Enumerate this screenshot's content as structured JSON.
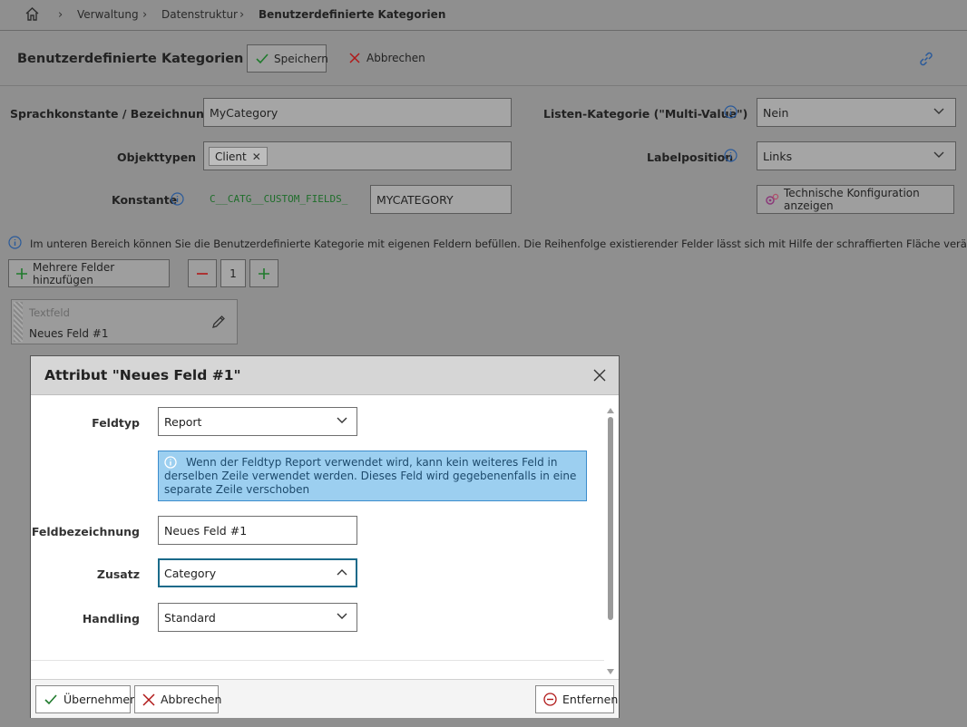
{
  "breadcrumb": {
    "items": [
      "Verwaltung",
      "Datenstruktur",
      "Benutzerdefinierte Kategorien"
    ]
  },
  "header": {
    "title": "Benutzerdefinierte Kategorien",
    "save_label": "Speichern",
    "cancel_label": "Abbrechen"
  },
  "form": {
    "name_label": "Sprachkonstante / Bezeichnung",
    "name_value": "MyCategory",
    "objecttypes_label": "Objekttypen",
    "objecttypes_tag": "Client",
    "constant_label": "Konstante",
    "constant_prefix": "C__CATG__CUSTOM_FIELDS_",
    "constant_value": "MYCATEGORY",
    "multivalue_label": "Listen-Kategorie (\"Multi-Value\")",
    "multivalue_value": "Nein",
    "labelpos_label": "Labelposition",
    "labelpos_value": "Links",
    "tech_config_label": "Technische Konfiguration anzeigen"
  },
  "info_text": "Im unteren Bereich können Sie die Benutzerdefinierte Kategorie mit eigenen Feldern befüllen. Die Reihenfolge existierender Felder lässt sich mit Hilfe der schraffierten Fläche verändern.",
  "fields_toolbar": {
    "add_label": "Mehrere Felder hinzufügen",
    "count": "1"
  },
  "field_card": {
    "type": "Textfeld",
    "name": "Neues Feld #1"
  },
  "modal": {
    "title": "Attribut \"Neues Feld #1\"",
    "feldtyp_label": "Feldtyp",
    "feldtyp_value": "Report",
    "info": "Wenn der Feldtyp Report verwendet wird, kann kein weiteres Feld in derselben Zeile verwendet werden. Dieses Feld wird gegebenenfalls in eine separate Zeile verschoben",
    "bezeichnung_label": "Feldbezeichnung",
    "bezeichnung_value": "Neues Feld #1",
    "zusatz_label": "Zusatz",
    "zusatz_value": "Category",
    "handling_label": "Handling",
    "handling_value": "Standard",
    "apply_label": "Übernehmen",
    "cancel_label": "Abbrechen",
    "remove_label": "Entfernen"
  },
  "colors": {
    "overlay": "#8f8f8f",
    "info_box": "#9ccff0",
    "focus_border": "#1a6a8a",
    "accent_link": "#2a5a9a"
  }
}
